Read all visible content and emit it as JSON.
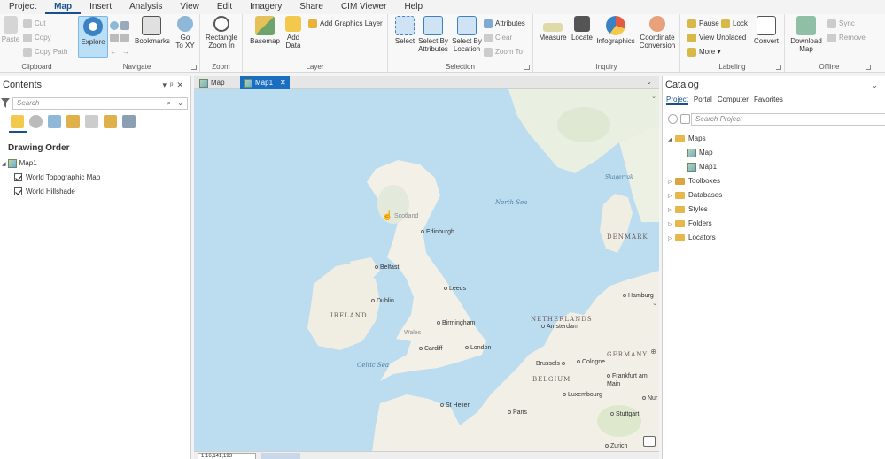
{
  "ribbon_tabs": [
    "Project",
    "Map",
    "Insert",
    "Analysis",
    "View",
    "Edit",
    "Imagery",
    "Share",
    "CIM Viewer",
    "Help"
  ],
  "active_tab": "Map",
  "clipboard": {
    "label": "Clipboard",
    "paste": "Paste",
    "cut": "Cut",
    "copy": "Copy",
    "copy_path": "Copy Path"
  },
  "navigate": {
    "label": "Navigate",
    "explore": "Explore",
    "bookmarks": "Bookmarks",
    "go_to_xy": "Go\nTo XY"
  },
  "zoom": {
    "label": "Zoom",
    "rectangle_zoom_in": "Rectangle\nZoom In"
  },
  "layer": {
    "label": "Layer",
    "basemap": "Basemap",
    "add_data": "Add\nData",
    "add_graphics_layer": "Add Graphics Layer"
  },
  "selection": {
    "label": "Selection",
    "select": "Select",
    "select_by_attributes": "Select By\nAttributes",
    "select_by_location": "Select By\nLocation",
    "attributes": "Attributes",
    "clear": "Clear",
    "zoom_to": "Zoom To"
  },
  "inquiry": {
    "label": "Inquiry",
    "measure": "Measure",
    "locate": "Locate",
    "infographics": "Infographics",
    "coordinate_conversion": "Coordinate\nConversion"
  },
  "labeling": {
    "label": "Labeling",
    "pause": "Pause",
    "lock": "Lock",
    "view_unplaced": "View Unplaced",
    "more": "More",
    "convert": "Convert"
  },
  "offline": {
    "label": "Offline",
    "download_map": "Download\nMap",
    "sync": "Sync",
    "remove": "Remove"
  },
  "contents": {
    "title": "Contents",
    "search_placeholder": "Search",
    "section": "Drawing Order",
    "map_name": "Map1",
    "layers": [
      "World Topographic Map",
      "World Hillshade"
    ]
  },
  "map_tabs": [
    "Map",
    "Map1"
  ],
  "active_map_tab": "Map1",
  "map_labels": {
    "scotland": "Scotland",
    "edinburgh": "Edinburgh",
    "north_sea": "North Sea",
    "skagerrak": "Skagerrak",
    "denmark": "DENMARK",
    "belfast": "Belfast",
    "leeds": "Leeds",
    "ireland": "IRELAND",
    "dublin": "Dublin",
    "hamburg": "Hamburg",
    "netherlands": "NETHERLANDS",
    "amsterdam": "Amsterdam",
    "birmingham": "Birmingham",
    "wales": "Wales",
    "cardiff": "Cardiff",
    "london": "London",
    "germany": "GERMANY",
    "celtic_sea": "Celtic Sea",
    "brussels": "Brussels",
    "cologne": "Cologne",
    "belgium": "BELGIUM",
    "frankfurt": "Frankfurt am\nMain",
    "luxembourg": "Luxembourg",
    "nur": "Nur",
    "st_helier": "St Helier",
    "paris": "Paris",
    "stuttgart": "Stuttgart",
    "zurich": "Zurich"
  },
  "scale_text": "1:16,141,193",
  "catalog": {
    "title": "Catalog",
    "tabs": [
      "Project",
      "Portal",
      "Computer",
      "Favorites"
    ],
    "active_tab": "Project",
    "search_placeholder": "Search Project",
    "maps": "Maps",
    "map_items": [
      "Map",
      "Map1"
    ],
    "folders": [
      "Toolboxes",
      "Databases",
      "Styles",
      "Folders",
      "Locators"
    ]
  },
  "colors": {
    "accent": "#1a4f8f",
    "active_tab": "#1a6ec0",
    "water": "#bcdcf0",
    "land": "#f2efe6"
  }
}
